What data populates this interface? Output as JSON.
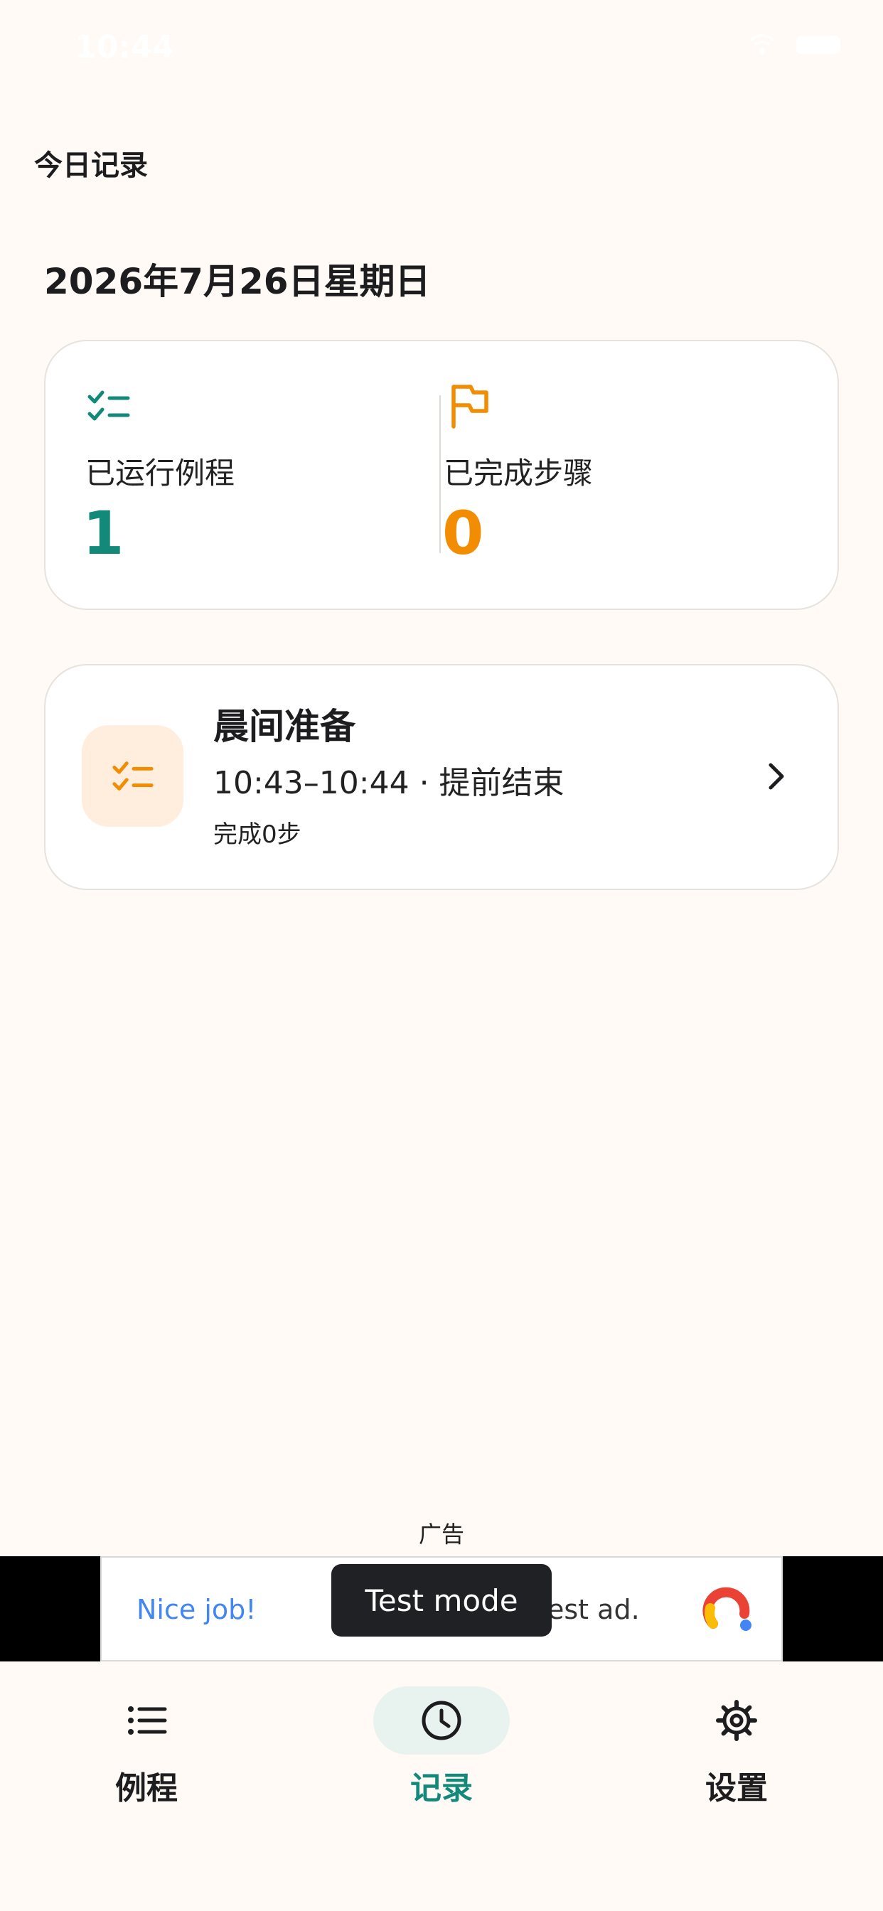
{
  "status_bar": {
    "time": "10:44"
  },
  "header": {
    "title": "今日记录"
  },
  "date": "2026年7月26日星期日",
  "summary": {
    "routines_run": {
      "label": "已运行例程",
      "value": "1",
      "icon": "checklist-icon",
      "color": "#13897A"
    },
    "steps_completed": {
      "label": "已完成步骤",
      "value": "0",
      "icon": "flag-icon",
      "color": "#F28C00"
    }
  },
  "records": [
    {
      "title": "晨间准备",
      "time": "10:43–10:44 · 提前结束",
      "steps": "完成0步",
      "icon": "checklist-icon"
    }
  ],
  "ad": {
    "label": "广告",
    "nice_job": "Nice job!",
    "text": "est ad.",
    "test_mode": "Test mode"
  },
  "nav": {
    "items": [
      {
        "label": "例程",
        "icon": "list-icon"
      },
      {
        "label": "记录",
        "icon": "clock-icon",
        "active": true
      },
      {
        "label": "设置",
        "icon": "gear-icon"
      }
    ]
  },
  "colors": {
    "background": "#FFFAF5",
    "accent_teal": "#13897A",
    "accent_orange": "#F28C00"
  }
}
